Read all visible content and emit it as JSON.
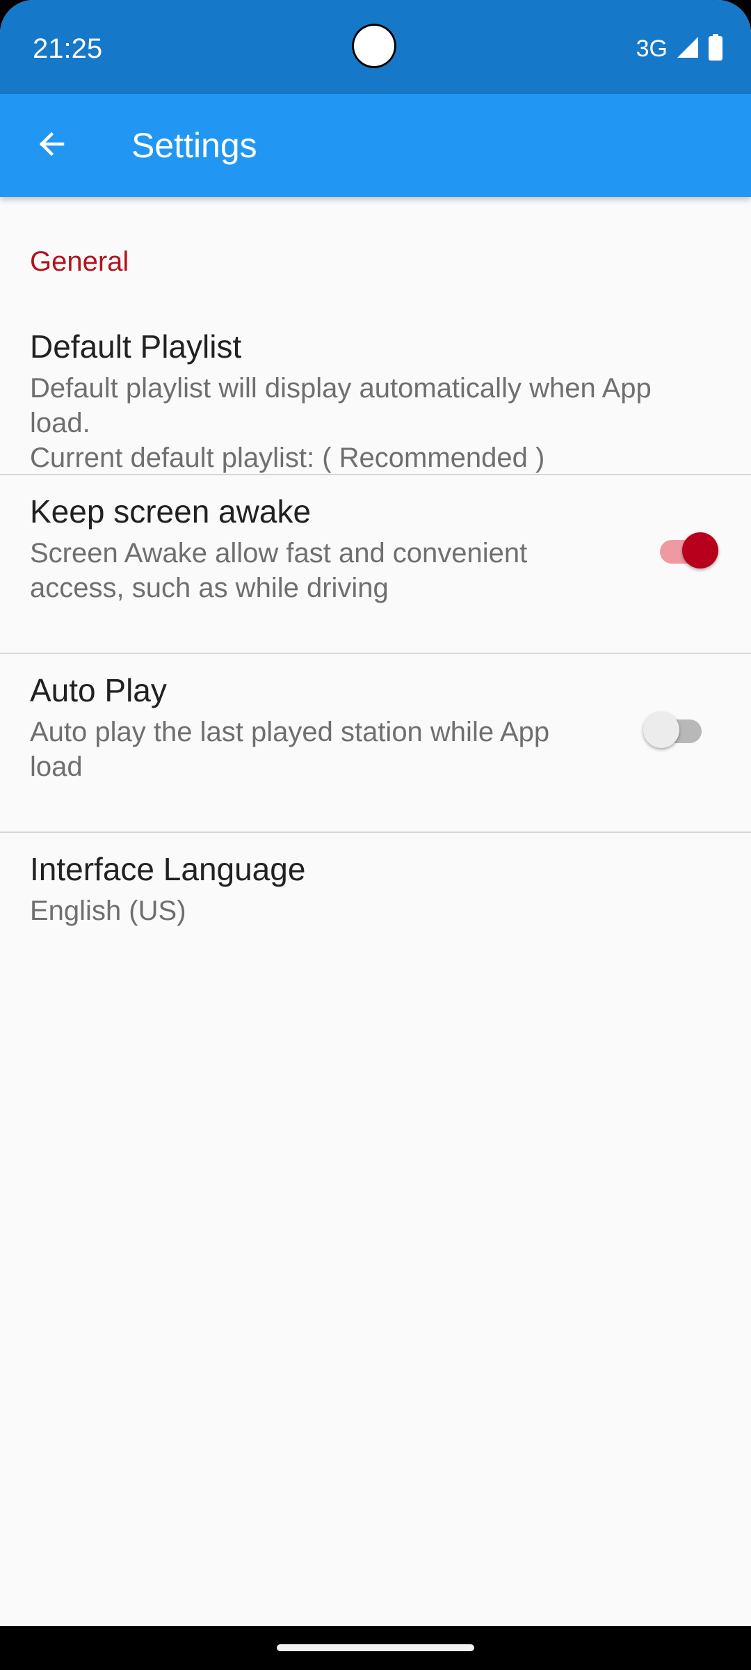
{
  "status_bar": {
    "time": "21:25",
    "network": "3G",
    "icons": [
      "cellular-signal-icon",
      "battery-icon"
    ]
  },
  "app_bar": {
    "title": "Settings",
    "back_icon": "arrow-back-icon"
  },
  "colors": {
    "status_bar": "#1678c9",
    "app_bar": "#2196f3",
    "accent": "#b8001c",
    "section_header": "#b5121b",
    "background": "#fafafa"
  },
  "section": {
    "header": "General"
  },
  "preferences": [
    {
      "title": "Default Playlist",
      "summary_lines": [
        "Default playlist will display automatically when App",
        "load.",
        "Current default playlist: ( Recommended )"
      ]
    },
    {
      "title": "Keep screen awake",
      "summary_lines": [
        "Screen Awake allow fast and convenient",
        "access, such as while driving"
      ],
      "switch_on": true
    },
    {
      "title": "Auto Play",
      "summary_lines": [
        "Auto play the last played station while App",
        "load"
      ],
      "switch_on": false
    },
    {
      "title": "Interface Language",
      "summary_lines": [
        "English (US)"
      ]
    }
  ]
}
